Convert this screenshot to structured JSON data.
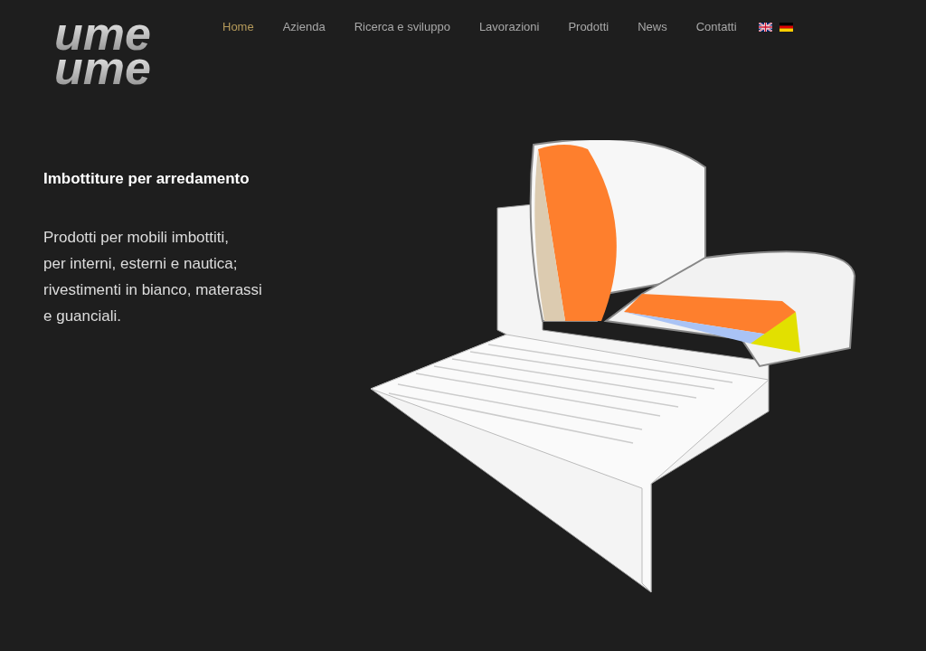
{
  "logo": {
    "line_1": "ume",
    "line_2": "ume"
  },
  "nav": {
    "items": [
      {
        "label": "Home",
        "selected": true
      },
      {
        "label": "Azienda",
        "selected": false
      },
      {
        "label": "Ricerca e sviluppo",
        "selected": false
      },
      {
        "label": "Lavorazioni",
        "selected": false
      },
      {
        "label": "Prodotti",
        "selected": false
      },
      {
        "label": "News",
        "selected": false
      },
      {
        "label": "Contatti",
        "selected": false
      }
    ],
    "languages": [
      {
        "kind": "uk"
      },
      {
        "kind": "de"
      }
    ]
  },
  "hero": {
    "title": "Imbottiture per arredamento",
    "text_lines": [
      "Prodotti per mobili imbottiti,",
      "per interni, esterni e nautica;",
      "rivestimenti in bianco, materassi",
      "e guanciali."
    ]
  }
}
